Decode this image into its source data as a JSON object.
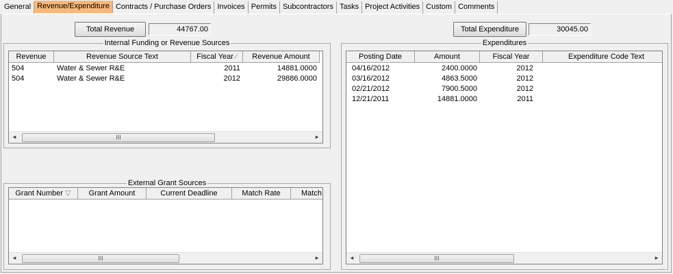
{
  "tabs": [
    {
      "label": "General"
    },
    {
      "label": "Revenue/Expenditure"
    },
    {
      "label": "Contracts / Purchase Orders"
    },
    {
      "label": "Invoices"
    },
    {
      "label": "Permits"
    },
    {
      "label": "Subcontractors"
    },
    {
      "label": "Tasks"
    },
    {
      "label": "Project Activities"
    },
    {
      "label": "Custom"
    },
    {
      "label": "Comments"
    }
  ],
  "revenue": {
    "total_button": "Total Revenue",
    "total_value": "44767.00",
    "internal_title": "Internal Funding or Revenue Sources",
    "columns": [
      "Revenue",
      "Revenue Source Text",
      "Fiscal Year",
      "Revenue Amount"
    ],
    "rows": [
      [
        "504",
        "Water & Sewer R&E",
        "2011",
        "14881.0000"
      ],
      [
        "504",
        "Water & Sewer R&E",
        "2012",
        "29886.0000"
      ]
    ],
    "grant_title": "External Grant Sources",
    "grant_columns": [
      "Grant Number",
      "Grant Amount",
      "Current Deadline",
      "Match Rate",
      "Match"
    ]
  },
  "expenditure": {
    "total_button": "Total Expenditure",
    "total_value": "30045.00",
    "title": "Expenditures",
    "columns": [
      "Posting Date",
      "Amount",
      "Fiscal Year",
      "Expenditure Code Text"
    ],
    "rows": [
      [
        "04/16/2012",
        "2400.0000",
        "2012",
        ""
      ],
      [
        "03/16/2012",
        "4863.5000",
        "2012",
        ""
      ],
      [
        "02/21/2012",
        "7900.5000",
        "2012",
        ""
      ],
      [
        "12/21/2011",
        "14881.0000",
        "2011",
        ""
      ]
    ]
  },
  "icons": {
    "scroll_left": "◄",
    "scroll_right": "►",
    "thumb_grip": "III",
    "sort_asc": "⁄",
    "sort_desc": "▽"
  }
}
